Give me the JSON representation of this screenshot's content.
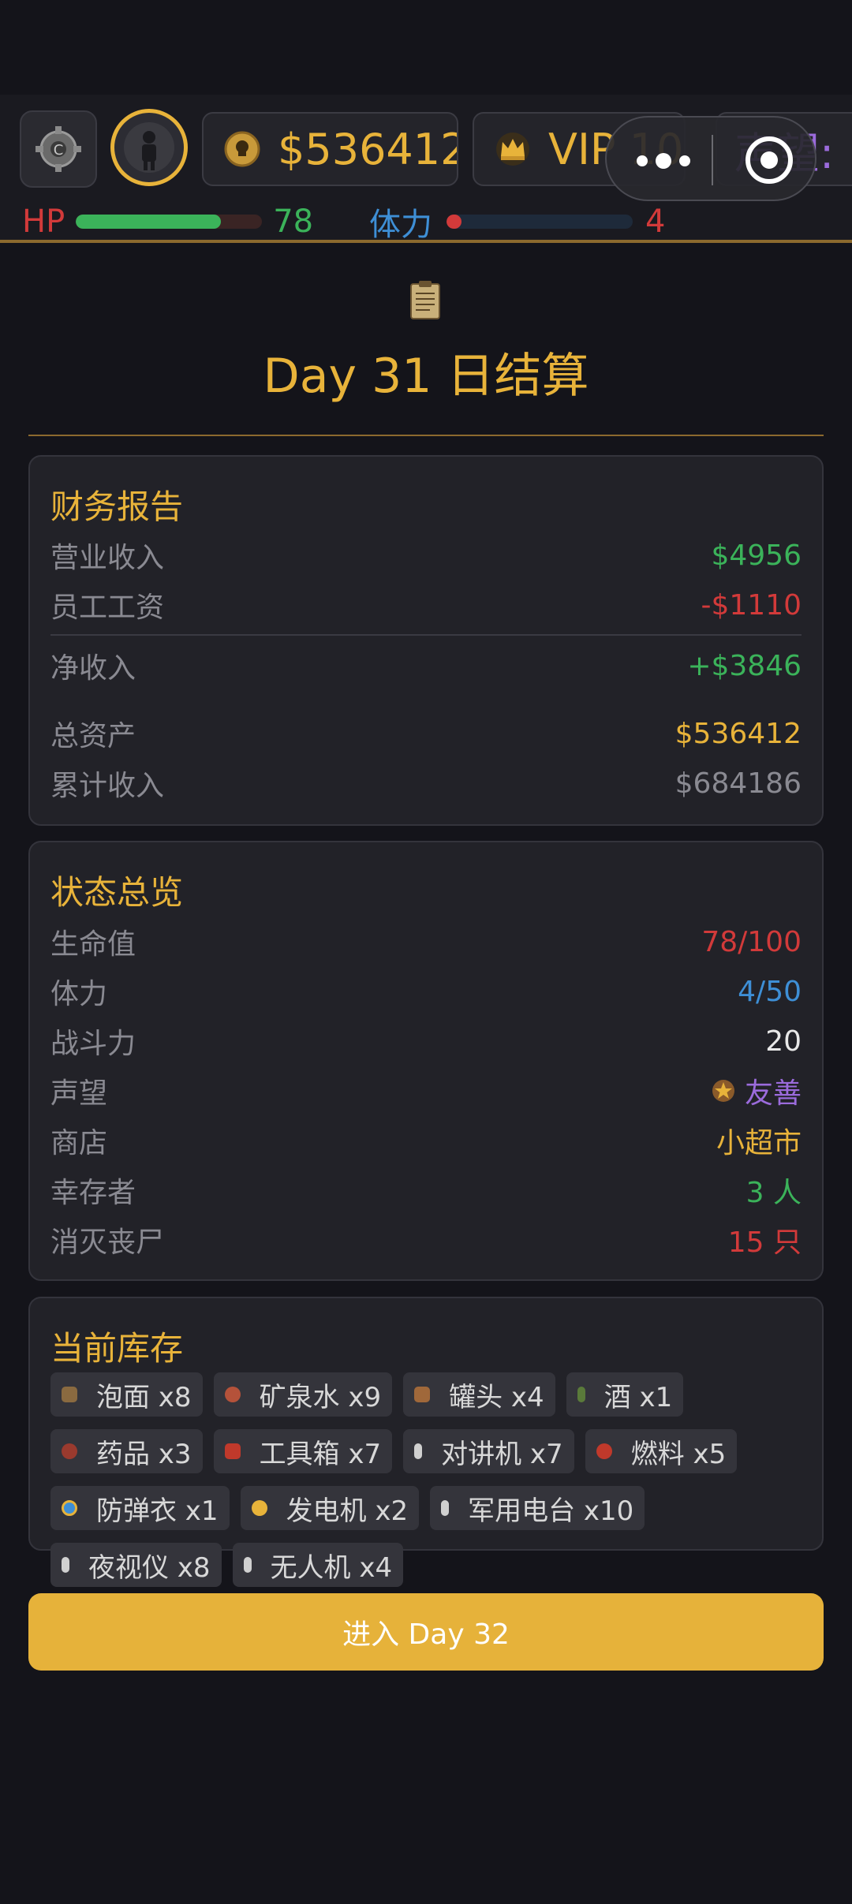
{
  "hud": {
    "money": "$536412",
    "vip": "VIP 10",
    "reputation_label": "声望:",
    "hp_label": "HP",
    "hp_value": "78",
    "hp_fraction": 0.78,
    "stamina_label": "体力",
    "stamina_value": "4",
    "stamina_fraction": 0.08,
    "colors": {
      "gold": "#e8b33a",
      "hp_green": "#3bb35a",
      "hp_label": "#d23a3a",
      "stamina_label": "#3e8fd6",
      "stamina_value": "#d23a3a"
    }
  },
  "page": {
    "icon": "clipboard-icon",
    "title": "Day 31 日结算"
  },
  "finance": {
    "heading": "财务报告",
    "rows": [
      {
        "label": "营业收入",
        "value": "$4956",
        "color": "#3bb35a"
      },
      {
        "label": "员工工资",
        "value": "-$1110",
        "color": "#d23a3a"
      },
      {
        "label": "净收入",
        "value": "+$3846",
        "color": "#3bb35a"
      },
      {
        "label": "总资产",
        "value": "$536412",
        "color": "#e8b33a"
      },
      {
        "label": "累计收入",
        "value": "$684186",
        "color": "#8a8a92"
      }
    ]
  },
  "status": {
    "heading": "状态总览",
    "rows": [
      {
        "label": "生命值",
        "value": "78/100",
        "color": "#d23a3a"
      },
      {
        "label": "体力",
        "value": "4/50",
        "color": "#3e8fd6"
      },
      {
        "label": "战斗力",
        "value": "20",
        "color": "#e8e8e8"
      },
      {
        "label": "声望",
        "value": "友善",
        "color": "#9b6bdc",
        "icon": "star-medal-icon"
      },
      {
        "label": "商店",
        "value": "小超市",
        "color": "#e8b33a"
      },
      {
        "label": "幸存者",
        "value": "3 人",
        "color": "#3bb35a"
      },
      {
        "label": "消灭丧尸",
        "value": "15 只",
        "color": "#d23a3a"
      }
    ]
  },
  "inventory": {
    "heading": "当前库存",
    "items": [
      {
        "label": "泡面 x8",
        "icon": "noodle-icon",
        "color": "#8a6a40"
      },
      {
        "label": "矿泉水 x9",
        "icon": "water-icon",
        "color": "#b5523a"
      },
      {
        "label": "罐头 x4",
        "icon": "can-icon",
        "color": "#a0683a"
      },
      {
        "label": "酒 x1",
        "icon": "bottle-icon",
        "color": "#5a7a3a"
      },
      {
        "label": "药品 x3",
        "icon": "medicine-icon",
        "color": "#9a3a2e"
      },
      {
        "label": "工具箱 x7",
        "icon": "toolbox-icon",
        "color": "#c0392b"
      },
      {
        "label": "对讲机 x7",
        "icon": "walkie-talkie-icon",
        "color": "#d0d0d0"
      },
      {
        "label": "燃料 x5",
        "icon": "fuel-icon",
        "color": "#c0392b"
      },
      {
        "label": "防弹衣 x1",
        "icon": "vest-icon",
        "color": "#3e8fd6"
      },
      {
        "label": "发电机 x2",
        "icon": "generator-icon",
        "color": "#e8b33a"
      },
      {
        "label": "军用电台 x10",
        "icon": "radio-icon",
        "color": "#d0d0d0"
      },
      {
        "label": "夜视仪 x8",
        "icon": "night-vision-icon",
        "color": "#d0d0d0"
      },
      {
        "label": "无人机 x4",
        "icon": "drone-icon",
        "color": "#d0d0d0"
      }
    ]
  },
  "next_button": "进入 Day 32"
}
